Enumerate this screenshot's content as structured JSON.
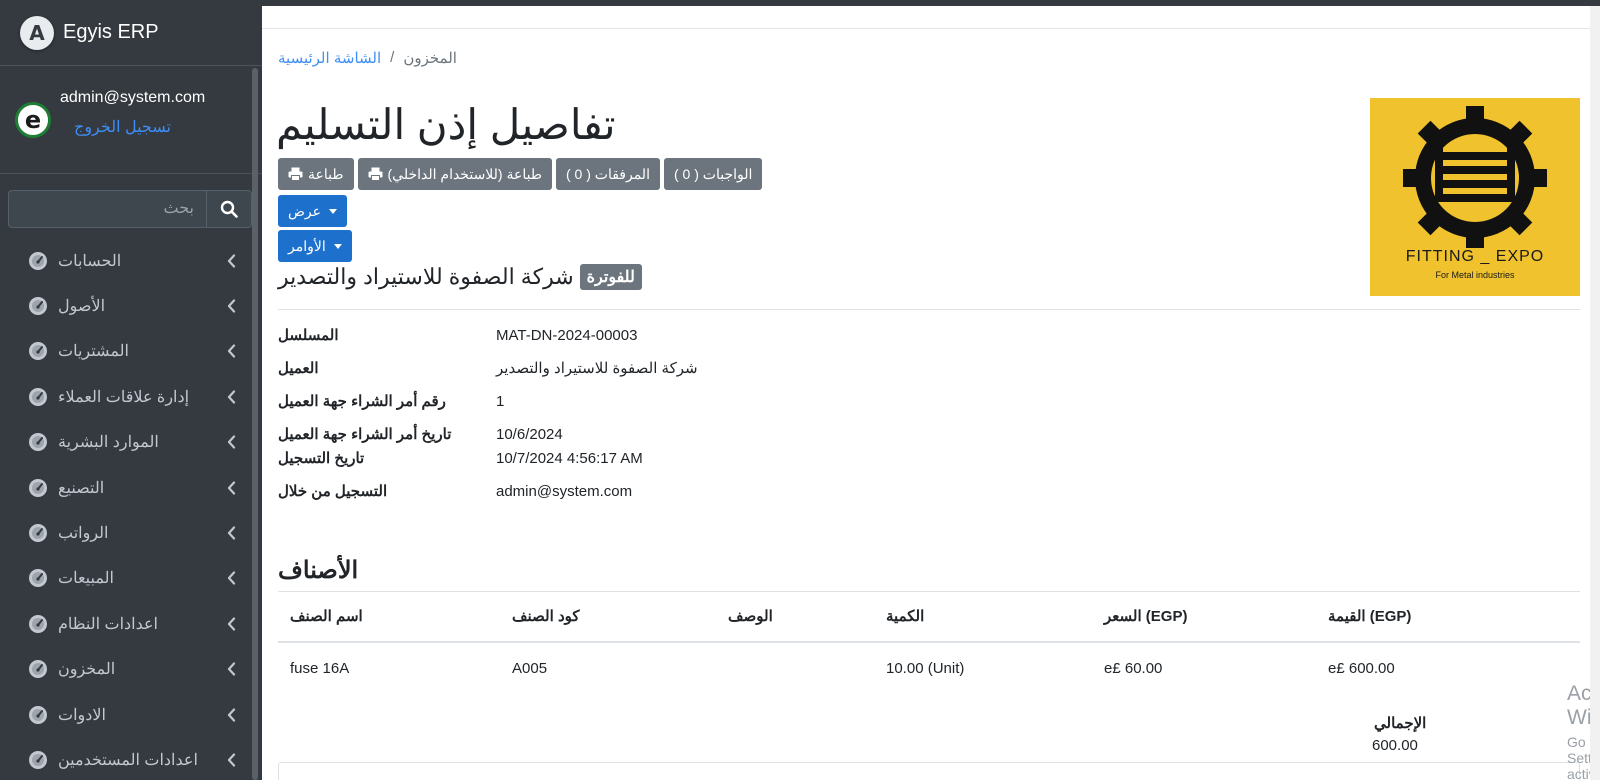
{
  "app": {
    "name": "Egyis ERP",
    "logo_letter": "A"
  },
  "user": {
    "email": "admin@system.com",
    "logout_label": "تسجيل الخروج",
    "avatar_letter": "e"
  },
  "sidebar": {
    "search_placeholder": "بحث",
    "items": [
      {
        "label": "الحسابات",
        "icon": "dashboard-gauge-icon"
      },
      {
        "label": "الأصول",
        "icon": "dashboard-gauge-icon"
      },
      {
        "label": "المشتريات",
        "icon": "dashboard-gauge-icon"
      },
      {
        "label": "إدارة علاقات العملاء",
        "icon": "dashboard-gauge-icon"
      },
      {
        "label": "الموارد البشرية",
        "icon": "dashboard-gauge-icon"
      },
      {
        "label": "التصنيع",
        "icon": "dashboard-gauge-icon"
      },
      {
        "label": "الرواتب",
        "icon": "dashboard-gauge-icon"
      },
      {
        "label": "المبيعات",
        "icon": "dashboard-gauge-icon"
      },
      {
        "label": "اعدادات النظام",
        "icon": "dashboard-gauge-icon"
      },
      {
        "label": "المخزون",
        "icon": "dashboard-gauge-icon"
      },
      {
        "label": "الادوات",
        "icon": "dashboard-gauge-icon"
      },
      {
        "label": "اعدادات المستخدمين",
        "icon": "dashboard-gauge-icon"
      }
    ]
  },
  "breadcrumb": {
    "home": "الشاشة الرئيسية",
    "separator": "/",
    "current": "المخزون"
  },
  "page": {
    "title": "تفاصيل إذن التسليم",
    "buttons": {
      "print": "طباعة",
      "print_internal": "طباعة (للاستخدام الداخلي)",
      "attachments": "المرفقات ( 0 )",
      "tasks": "الواجبات ( 0 )",
      "view": "عرض",
      "commands": "الأوامر"
    },
    "company_name": "شركة الصفوة للاستيراد والتصدير",
    "status_badge": "للفوترة"
  },
  "logo": {
    "caption": "FITTING _ EXPO",
    "subcaption": "For Metal industries",
    "bg_color": "#f0c22d"
  },
  "details": [
    {
      "label": "المسلسل",
      "value": "MAT-DN-2024-00003"
    },
    {
      "label": "العميل",
      "value": "شركة الصفوة للاستيراد والتصدير"
    },
    {
      "label": "رقم أمر الشراء جهة العميل",
      "value": "1"
    },
    {
      "label": "تاريخ أمر الشراء جهة العميل",
      "value": "10/6/2024"
    },
    {
      "label": "تاريخ التسجيل",
      "value": "10/7/2024 4:56:17 AM"
    },
    {
      "label": "التسجيل من خلال",
      "value": "admin@system.com"
    }
  ],
  "items": {
    "title": "الأصناف",
    "headers": [
      "اسم الصنف",
      "كود الصنف",
      "الوصف",
      "الكمية",
      "السعر (EGP)",
      "القيمة (EGP)"
    ],
    "rows": [
      [
        "fuse 16A",
        "A005",
        "",
        "10.00 (Unit)",
        "e£ 60.00",
        "e£ 600.00"
      ]
    ],
    "total_label": "الإجمالي",
    "total_value": "600.00"
  },
  "watermark": {
    "title": "Activate Windows",
    "subtitle": "Go to Settings to activate Windows."
  },
  "colors": {
    "sidebar_bg": "#343a40",
    "primary": "#1e70cd",
    "secondary": "#6c757d",
    "link": "#3f8ef5"
  }
}
